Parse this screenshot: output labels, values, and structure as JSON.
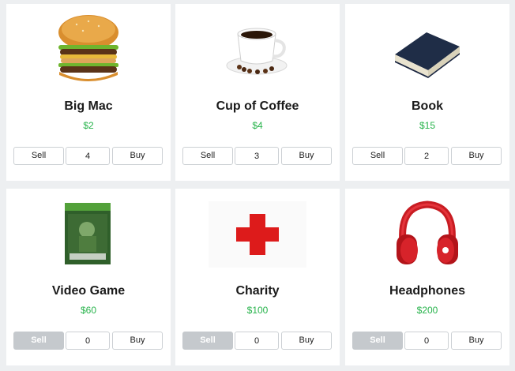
{
  "items": [
    {
      "name": "Big Mac",
      "price": "$2",
      "quantity": "4",
      "sell_label": "Sell",
      "buy_label": "Buy",
      "sell_enabled": true,
      "image_icon": "burger-image"
    },
    {
      "name": "Cup of Coffee",
      "price": "$4",
      "quantity": "3",
      "sell_label": "Sell",
      "buy_label": "Buy",
      "sell_enabled": true,
      "image_icon": "coffee-cup-image"
    },
    {
      "name": "Book",
      "price": "$15",
      "quantity": "2",
      "sell_label": "Sell",
      "buy_label": "Buy",
      "sell_enabled": true,
      "image_icon": "book-image"
    },
    {
      "name": "Video Game",
      "price": "$60",
      "quantity": "0",
      "sell_label": "Sell",
      "buy_label": "Buy",
      "sell_enabled": false,
      "image_icon": "video-game-box-image"
    },
    {
      "name": "Charity",
      "price": "$100",
      "quantity": "0",
      "sell_label": "Sell",
      "buy_label": "Buy",
      "sell_enabled": false,
      "image_icon": "red-cross-image"
    },
    {
      "name": "Headphones",
      "price": "$200",
      "quantity": "0",
      "sell_label": "Sell",
      "buy_label": "Buy",
      "sell_enabled": false,
      "image_icon": "headphones-image"
    }
  ],
  "colors": {
    "price": "#27b34b",
    "background": "#edeff1",
    "disabled_button": "#c5c9cd"
  }
}
